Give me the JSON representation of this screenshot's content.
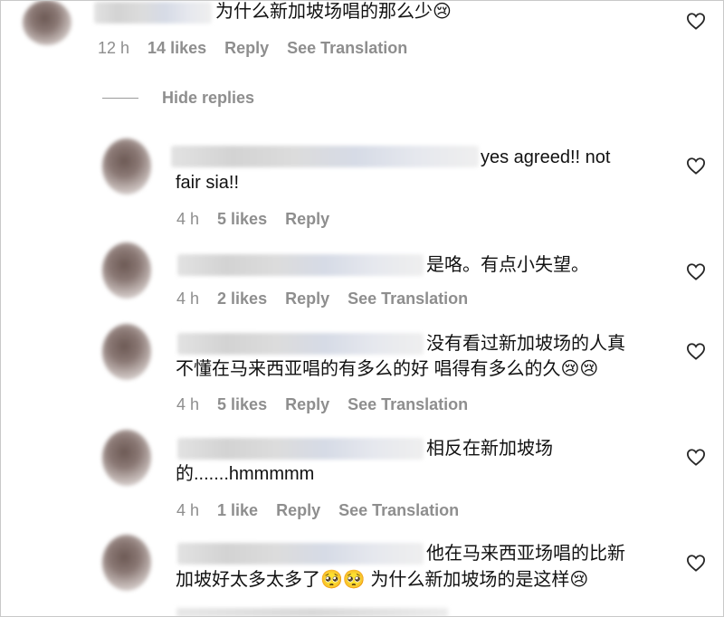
{
  "top_comment": {
    "text": "为什么新加坡场唱的那么少😢",
    "time": "12 h",
    "likes": "14 likes",
    "reply": "Reply",
    "translate": "See Translation"
  },
  "hide_replies": "Hide replies",
  "replies": [
    {
      "line1": "yes agreed!! not",
      "line2": "fair sia!!",
      "time": "4 h",
      "likes": "5 likes",
      "reply": "Reply"
    },
    {
      "line1": "是咯。有点小失望。",
      "time": "4 h",
      "likes": "2 likes",
      "reply": "Reply",
      "translate": "See Translation"
    },
    {
      "line1": "没有看过新加坡场的人真",
      "line2": "不懂在马来西亚唱的有多么的好 唱得有多么的久😢😢",
      "time": "4 h",
      "likes": "5 likes",
      "reply": "Reply",
      "translate": "See Translation"
    },
    {
      "line1": "相反在新加坡场",
      "line2": "的.......hmmmmm",
      "time": "4 h",
      "likes": "1 like",
      "reply": "Reply",
      "translate": "See Translation"
    },
    {
      "line1": "他在马来西亚场唱的比新",
      "line2": "加坡好太多太多了🥺🥺 为什么新加坡场的是这样😢"
    }
  ],
  "icons": {
    "like": "heart-icon"
  }
}
